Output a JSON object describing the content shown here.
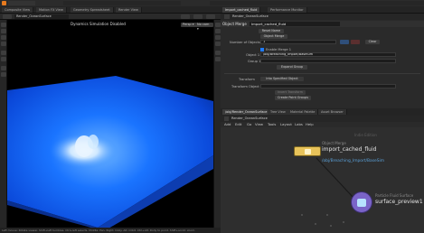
{
  "window": {
    "top_title": "Render_OceanSurface"
  },
  "desktop_tabs": [
    {
      "label": "Composite View"
    },
    {
      "label": "Motion FX View"
    },
    {
      "label": "Geometry Spreadsheet"
    },
    {
      "label": "Render View"
    }
  ],
  "right_tabs": [
    {
      "label": "Import_cached_fluid"
    },
    {
      "label": "Performance Monitor"
    }
  ],
  "viewport": {
    "header_text": "Dynamics Simulation Disabled",
    "persp_label": "Persp ▾",
    "cam_label": "No cam ▾"
  },
  "status_bar": {
    "text": "Left mouse: Rotate viewer. Shift+left tumbles. Ctrl+left selects. Middle: Pan. Right: Dolly. Alt: Orbit. Ctrl+Alt: Dolly to point. Shift+scroll: zoom."
  },
  "params": {
    "path_node": "Render_OceanSurface",
    "node_type": "Object Merge",
    "node_name": "Import_cached_fluid",
    "reset_label": "Reset Name",
    "object_merge_btn": "Object Merge",
    "num_objects_label": "Number of Objects",
    "num_objects_value": "1",
    "clear_btn": "Clear",
    "enable_merge_label": "Enable Merge 1",
    "object1_label": "Object 1",
    "object1_value": "/obj/Breaching_Import/BaseSim",
    "group1_label": "Group 1",
    "expand_group_btn": "Expand Group",
    "transform_label": "Transform",
    "transform_value": "Into Specified Object",
    "transform_object_label": "Transform Object",
    "invert_transform_btn": "Invert Transform",
    "create_point_groups_btn": "Create Point Groups"
  },
  "network": {
    "tabs": [
      {
        "label": "/obj/Render_OceanSurface"
      },
      {
        "label": "Tree View"
      },
      {
        "label": "Material Palette"
      },
      {
        "label": "Asset Browser"
      }
    ],
    "menu": [
      "Add",
      "Edit",
      "Go",
      "View",
      "Tools",
      "Layout",
      "Labs",
      "Help"
    ],
    "path_text": "Render_OceanSurface",
    "context_watermark": "Indie Edition",
    "node1": {
      "type": "Object Merge",
      "name": "import_cached_fluid",
      "path": "/obj/Breaching_Import/BaseSim"
    },
    "node2": {
      "type": "Particle Fluid Surface",
      "name": "surface_preview1"
    }
  },
  "colors": {
    "accent_blue": "#1f7bff",
    "node_path_blue": "#5aa0d8",
    "node_yellow": "#e8c35a",
    "node_purple": "#7a64c8"
  }
}
